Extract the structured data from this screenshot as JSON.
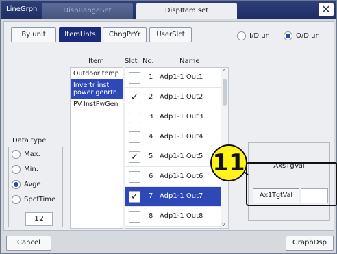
{
  "window": {
    "app_title": "LineGrph",
    "tabs": [
      {
        "label": "DispRangeSet"
      },
      {
        "label": "DispItem set"
      }
    ]
  },
  "view_buttons": [
    "By unit",
    "ItemUnts",
    "ChngPrYr",
    "UserSlct"
  ],
  "unit_radios": [
    {
      "label": "I/D un",
      "selected": false
    },
    {
      "label": "O/D un",
      "selected": true
    }
  ],
  "headers": {
    "item": "Item",
    "slct": "Slct",
    "no": "No.",
    "name": "Name"
  },
  "items": [
    "Outdoor temp",
    "Invertr inst power genrtn",
    "PV InstPwGen"
  ],
  "rows": [
    {
      "checked": false,
      "no": "1",
      "name": "Adp1-1 Out1"
    },
    {
      "checked": true,
      "no": "2",
      "name": "Adp1-1 Out2"
    },
    {
      "checked": false,
      "no": "3",
      "name": "Adp1-1 Out3"
    },
    {
      "checked": false,
      "no": "4",
      "name": "Adp1-1 Out4"
    },
    {
      "checked": true,
      "no": "5",
      "name": "Adp1-1 Out5"
    },
    {
      "checked": false,
      "no": "6",
      "name": "Adp1-1 Out6"
    },
    {
      "checked": true,
      "no": "7",
      "name": "Adp1-1 Out7"
    },
    {
      "checked": false,
      "no": "8",
      "name": "Adp1-1 Out8"
    }
  ],
  "data_type": {
    "label": "Data type",
    "options": [
      {
        "label": "Max.",
        "selected": false
      },
      {
        "label": "Min.",
        "selected": false
      },
      {
        "label": "Avge",
        "selected": true
      },
      {
        "label": "SpcfTime",
        "selected": false
      }
    ],
    "time_value": "12"
  },
  "axis": {
    "title": "AxsTgVal",
    "button": "Ax1TgtVal",
    "value": ""
  },
  "callout": "11",
  "footer": {
    "cancel": "Cancel",
    "graph": "GraphDsp"
  },
  "colors": {
    "accent": "#2f48b8",
    "titlebar": "#1f2e63",
    "callout": "#fff31a"
  }
}
